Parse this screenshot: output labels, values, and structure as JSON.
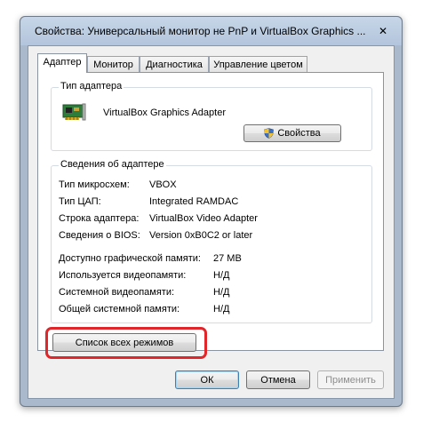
{
  "window": {
    "title": "Свойства: Универсальный монитор не PnP и VirtualBox Graphics ...",
    "close_glyph": "✕"
  },
  "tabs": [
    {
      "label": "Адаптер",
      "active": true
    },
    {
      "label": "Монитор",
      "active": false
    },
    {
      "label": "Диагностика",
      "active": false
    },
    {
      "label": "Управление цветом",
      "active": false
    }
  ],
  "adapter_type": {
    "group_title": "Тип адаптера",
    "icon": "graphics-card-icon",
    "adapter_name": "VirtualBox Graphics Adapter",
    "properties_button": "Свойства",
    "properties_button_icon": "uac-shield-icon"
  },
  "adapter_info": {
    "group_title": "Сведения об адаптере",
    "rows": [
      {
        "label": "Тип микросхем:",
        "value": "VBOX"
      },
      {
        "label": "Тип ЦАП:",
        "value": "Integrated RAMDAC"
      },
      {
        "label": "Строка адаптера:",
        "value": "VirtualBox Video Adapter"
      },
      {
        "label": "Сведения о BIOS:",
        "value": "Version 0xB0C2 or later"
      }
    ],
    "memory_rows": [
      {
        "label": "Доступно графической памяти:",
        "value": "27 MB"
      },
      {
        "label": "Используется видеопамяти:",
        "value": "Н/Д"
      },
      {
        "label": "Системной видеопамяти:",
        "value": "Н/Д"
      },
      {
        "label": "Общей системной памяти:",
        "value": "Н/Д"
      }
    ]
  },
  "list_modes_button": "Список всех режимов",
  "buttons": {
    "ok": "ОК",
    "cancel": "Отмена",
    "apply": "Применить"
  },
  "colors": {
    "highlight": "#e0262b",
    "window_frame": "#aab9cc"
  }
}
